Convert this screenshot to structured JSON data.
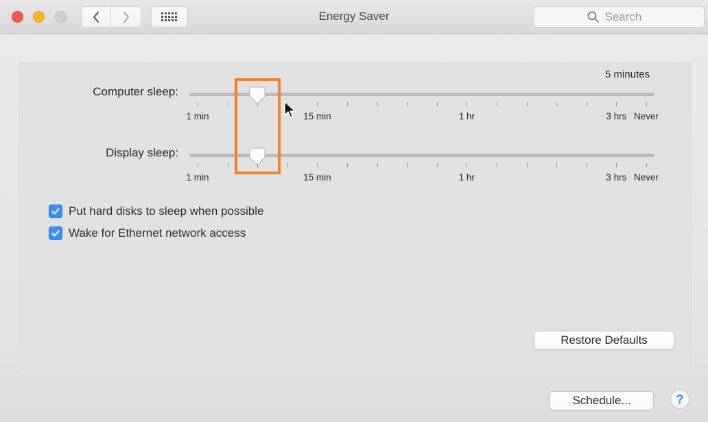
{
  "window": {
    "title": "Energy Saver",
    "traffic_lights": {
      "close_color": "#f25a52",
      "minimize_color": "#fbb726",
      "zoom_color": "#cfcfcf"
    },
    "nav": {
      "back_icon": "chevron-left-icon",
      "forward_icon": "chevron-right-icon",
      "grid_icon": "show-all-grid-icon"
    },
    "search": {
      "placeholder": "Search",
      "value": "",
      "icon": "search-icon"
    }
  },
  "sleep": {
    "current_value_text": "5 minutes",
    "tick_count": 16,
    "sliders": [
      {
        "id": "computer",
        "label": "Computer sleep:",
        "value_tick_index": 2,
        "value": "5 minutes"
      },
      {
        "id": "display",
        "label": "Display sleep:",
        "value_tick_index": 2,
        "value": "5 minutes"
      }
    ],
    "tick_labels": [
      {
        "text": "1 min",
        "tick_index": 0
      },
      {
        "text": "15 min",
        "tick_index": 4
      },
      {
        "text": "1 hr",
        "tick_index": 9
      },
      {
        "text": "3 hrs",
        "tick_index": 14
      },
      {
        "text": "Never",
        "tick_index": 15
      }
    ]
  },
  "options": [
    {
      "label": "Put hard disks to sleep when possible",
      "checked": true
    },
    {
      "label": "Wake for Ethernet network access",
      "checked": true
    }
  ],
  "buttons": {
    "restore_defaults": "Restore Defaults",
    "schedule": "Schedule...",
    "help": "?"
  },
  "colors": {
    "accent": "#3b8ff0",
    "highlight_annotation": "#f57f2a"
  }
}
